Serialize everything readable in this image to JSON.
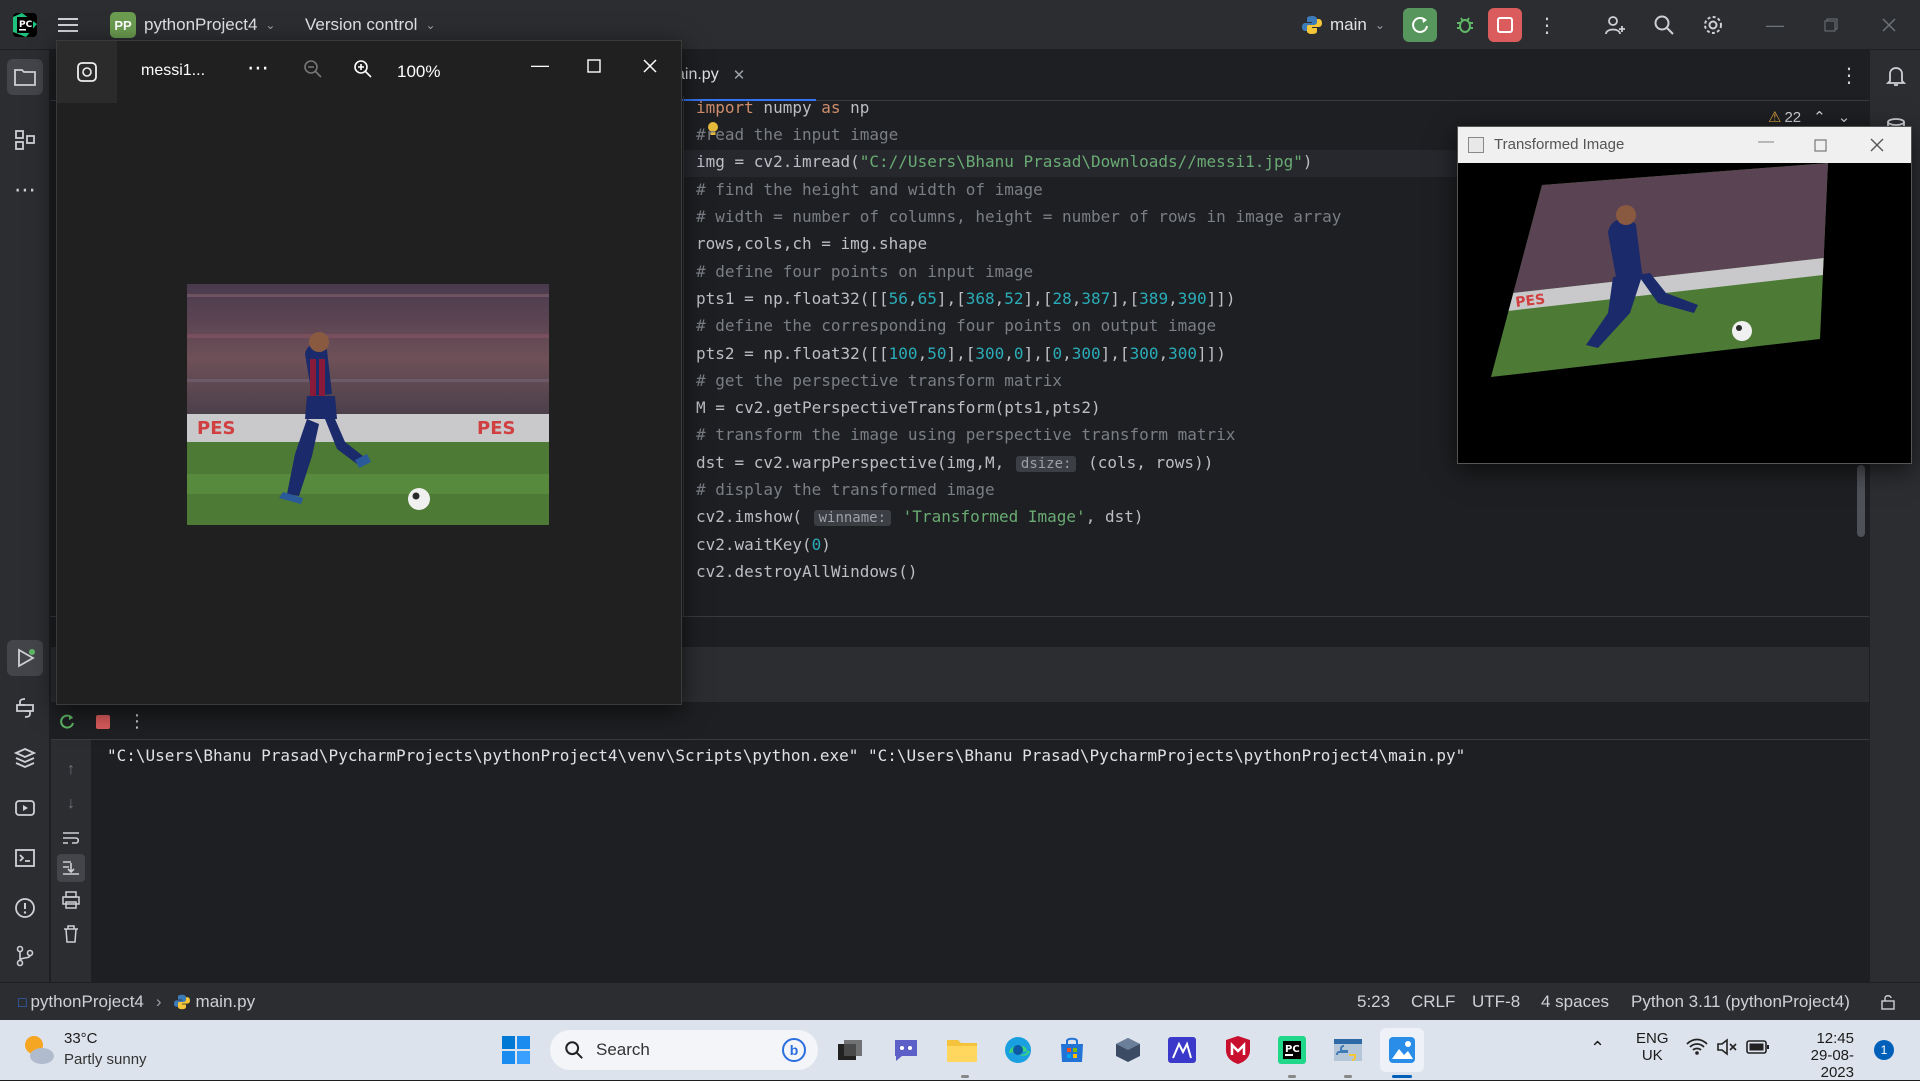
{
  "topbar": {
    "project_badge": "PP",
    "project_name": "pythonProject4",
    "vcs_label": "Version control",
    "run_config": "main"
  },
  "editor": {
    "tab_label": "ain.py",
    "warnings_count": "22",
    "code_lines": [
      {
        "parts": [
          [
            "kw",
            "import"
          ],
          [
            "pl",
            " numpy "
          ],
          [
            "kw",
            "as"
          ],
          [
            "pl",
            " np"
          ]
        ]
      },
      {
        "parts": [
          [
            "cm",
            "#read the input image"
          ]
        ]
      },
      {
        "parts": [
          [
            "pl",
            "img = cv2.imread("
          ],
          [
            "st",
            "\"C://Users\\Bhanu Prasad\\Downloads//messi1.jpg\""
          ],
          [
            "pl",
            ")"
          ]
        ]
      },
      {
        "parts": [
          [
            "cm",
            "# find the height and width of image"
          ]
        ]
      },
      {
        "parts": [
          [
            "cm",
            "# width = number of columns, height = number of rows in image array"
          ]
        ]
      },
      {
        "parts": [
          [
            "pl",
            "rows,cols,ch = img.shape"
          ]
        ]
      },
      {
        "parts": [
          [
            "cm",
            "# define four points on input image"
          ]
        ]
      },
      {
        "parts": [
          [
            "pl",
            "pts1 = np.float32([["
          ],
          [
            "nm",
            "56"
          ],
          [
            "pl",
            ","
          ],
          [
            "nm",
            "65"
          ],
          [
            "pl",
            "],["
          ],
          [
            "nm",
            "368"
          ],
          [
            "pl",
            ","
          ],
          [
            "nm",
            "52"
          ],
          [
            "pl",
            "],["
          ],
          [
            "nm",
            "28"
          ],
          [
            "pl",
            ","
          ],
          [
            "nm",
            "387"
          ],
          [
            "pl",
            "],["
          ],
          [
            "nm",
            "389"
          ],
          [
            "pl",
            ","
          ],
          [
            "nm",
            "390"
          ],
          [
            "pl",
            "]])"
          ]
        ]
      },
      {
        "parts": [
          [
            "cm",
            "# define the corresponding four points on output image"
          ]
        ]
      },
      {
        "parts": [
          [
            "pl",
            "pts2 = np.float32([["
          ],
          [
            "nm",
            "100"
          ],
          [
            "pl",
            ","
          ],
          [
            "nm",
            "50"
          ],
          [
            "pl",
            "],["
          ],
          [
            "nm",
            "300"
          ],
          [
            "pl",
            ","
          ],
          [
            "nm",
            "0"
          ],
          [
            "pl",
            "],["
          ],
          [
            "nm",
            "0"
          ],
          [
            "pl",
            ","
          ],
          [
            "nm",
            "300"
          ],
          [
            "pl",
            "],["
          ],
          [
            "nm",
            "300"
          ],
          [
            "pl",
            ","
          ],
          [
            "nm",
            "300"
          ],
          [
            "pl",
            "]])"
          ]
        ]
      },
      {
        "parts": [
          [
            "cm",
            "# get the perspective transform matrix"
          ]
        ]
      },
      {
        "parts": [
          [
            "pl",
            "M = cv2.getPerspectiveTransform(pts1,pts2)"
          ]
        ]
      },
      {
        "parts": [
          [
            "cm",
            "# transform the image using perspective transform matrix"
          ]
        ]
      },
      {
        "parts": [
          [
            "pl",
            "dst = cv2.warpPerspective(img,M, "
          ],
          [
            "hint",
            "dsize:"
          ],
          [
            "pl",
            " (cols, rows))"
          ]
        ]
      },
      {
        "parts": [
          [
            "cm",
            "# display the transformed image"
          ]
        ]
      },
      {
        "parts": [
          [
            "pl",
            "cv2.imshow( "
          ],
          [
            "hint",
            "winname:"
          ],
          [
            "st",
            " 'Transformed Image'"
          ],
          [
            "pl",
            ", dst)"
          ]
        ]
      },
      {
        "parts": [
          [
            "pl",
            "cv2.waitKey("
          ],
          [
            "nm",
            "0"
          ],
          [
            "pl",
            ")"
          ]
        ]
      },
      {
        "parts": [
          [
            "pl",
            "cv2.destroyAllWindows()"
          ]
        ]
      }
    ]
  },
  "run": {
    "output": "\"C:\\Users\\Bhanu Prasad\\PycharmProjects\\pythonProject4\\venv\\Scripts\\python.exe\" \"C:\\Users\\Bhanu Prasad\\PycharmProjects\\pythonProject4\\main.py\""
  },
  "statusbar": {
    "project": "pythonProject4",
    "file": "main.py",
    "position": "5:23",
    "line_sep": "CRLF",
    "encoding": "UTF-8",
    "indent": "4 spaces",
    "interpreter": "Python 3.11 (pythonProject4)"
  },
  "photos": {
    "filename": "messi1...",
    "zoom": "100%"
  },
  "transformed": {
    "title": "Transformed Image"
  },
  "taskbar": {
    "temp": "33°C",
    "weather": "Partly sunny",
    "search": "Search",
    "lang1": "ENG",
    "lang2": "UK",
    "time": "12:45",
    "date": "29-08-2023",
    "notif": "1"
  }
}
